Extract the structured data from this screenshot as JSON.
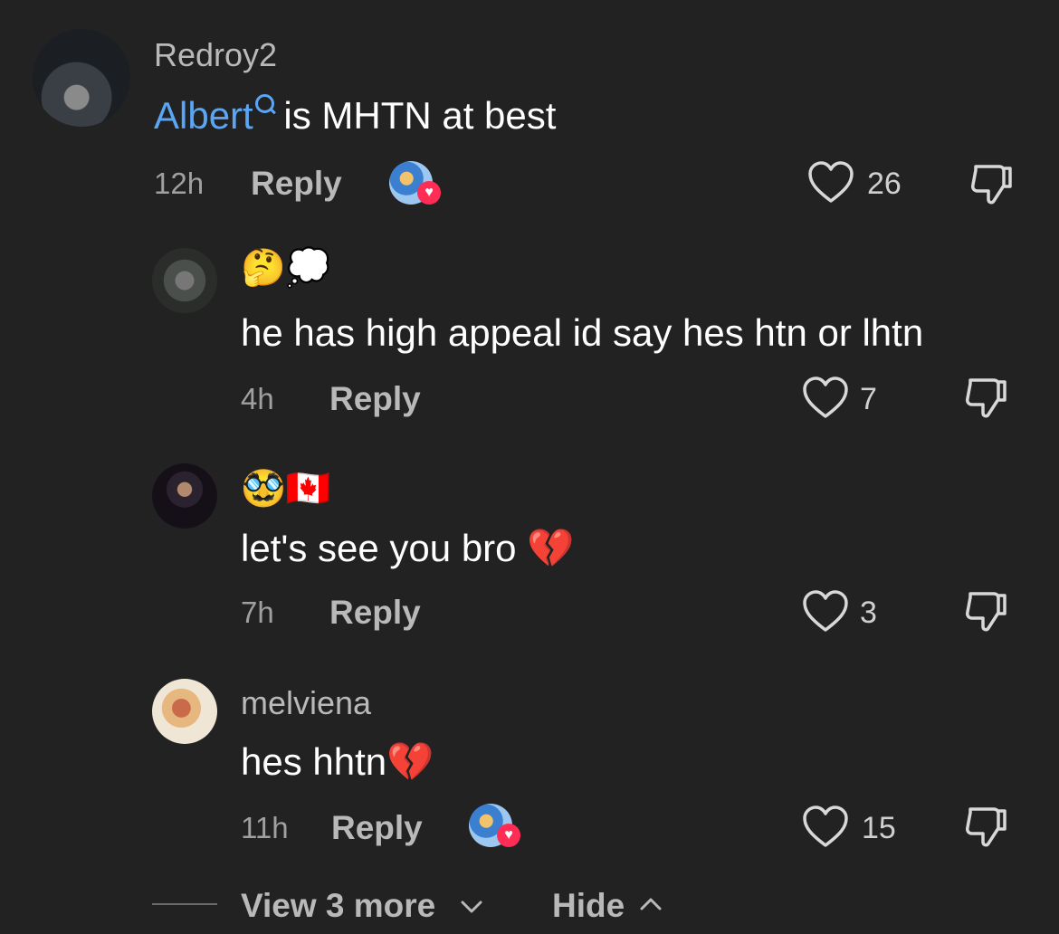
{
  "colors": {
    "background": "#222222",
    "mention": "#5aa6f5",
    "muted": "#b9b9b9",
    "heart_badge": "#ff2d55"
  },
  "main_comment": {
    "username": "Redroy2",
    "mention": "Albert",
    "text": " is MHTN at best",
    "time": "12h",
    "reply_label": "Reply",
    "likes": "26",
    "liked_by_creator_icon": "creator-heart-avatar"
  },
  "replies": [
    {
      "username_emojis": "🤔💭",
      "text": "he has high appeal id say hes htn or lhtn",
      "time": "4h",
      "reply_label": "Reply",
      "likes": "7"
    },
    {
      "username_emojis": "🥸🇨🇦",
      "text": "let's see you bro 💔",
      "time": "7h",
      "reply_label": "Reply",
      "likes": "3"
    },
    {
      "username": "melviena",
      "text": "hes hhtn💔",
      "time": "11h",
      "reply_label": "Reply",
      "likes": "15",
      "liked_by_creator_icon": "creator-heart-avatar"
    }
  ],
  "footer": {
    "view_more": "View 3 more",
    "hide": "Hide"
  },
  "icons": {
    "like": "heart-outline-icon",
    "dislike": "thumbs-down-icon",
    "expand": "chevron-down-icon",
    "collapse": "chevron-up-icon",
    "search": "search-icon"
  }
}
